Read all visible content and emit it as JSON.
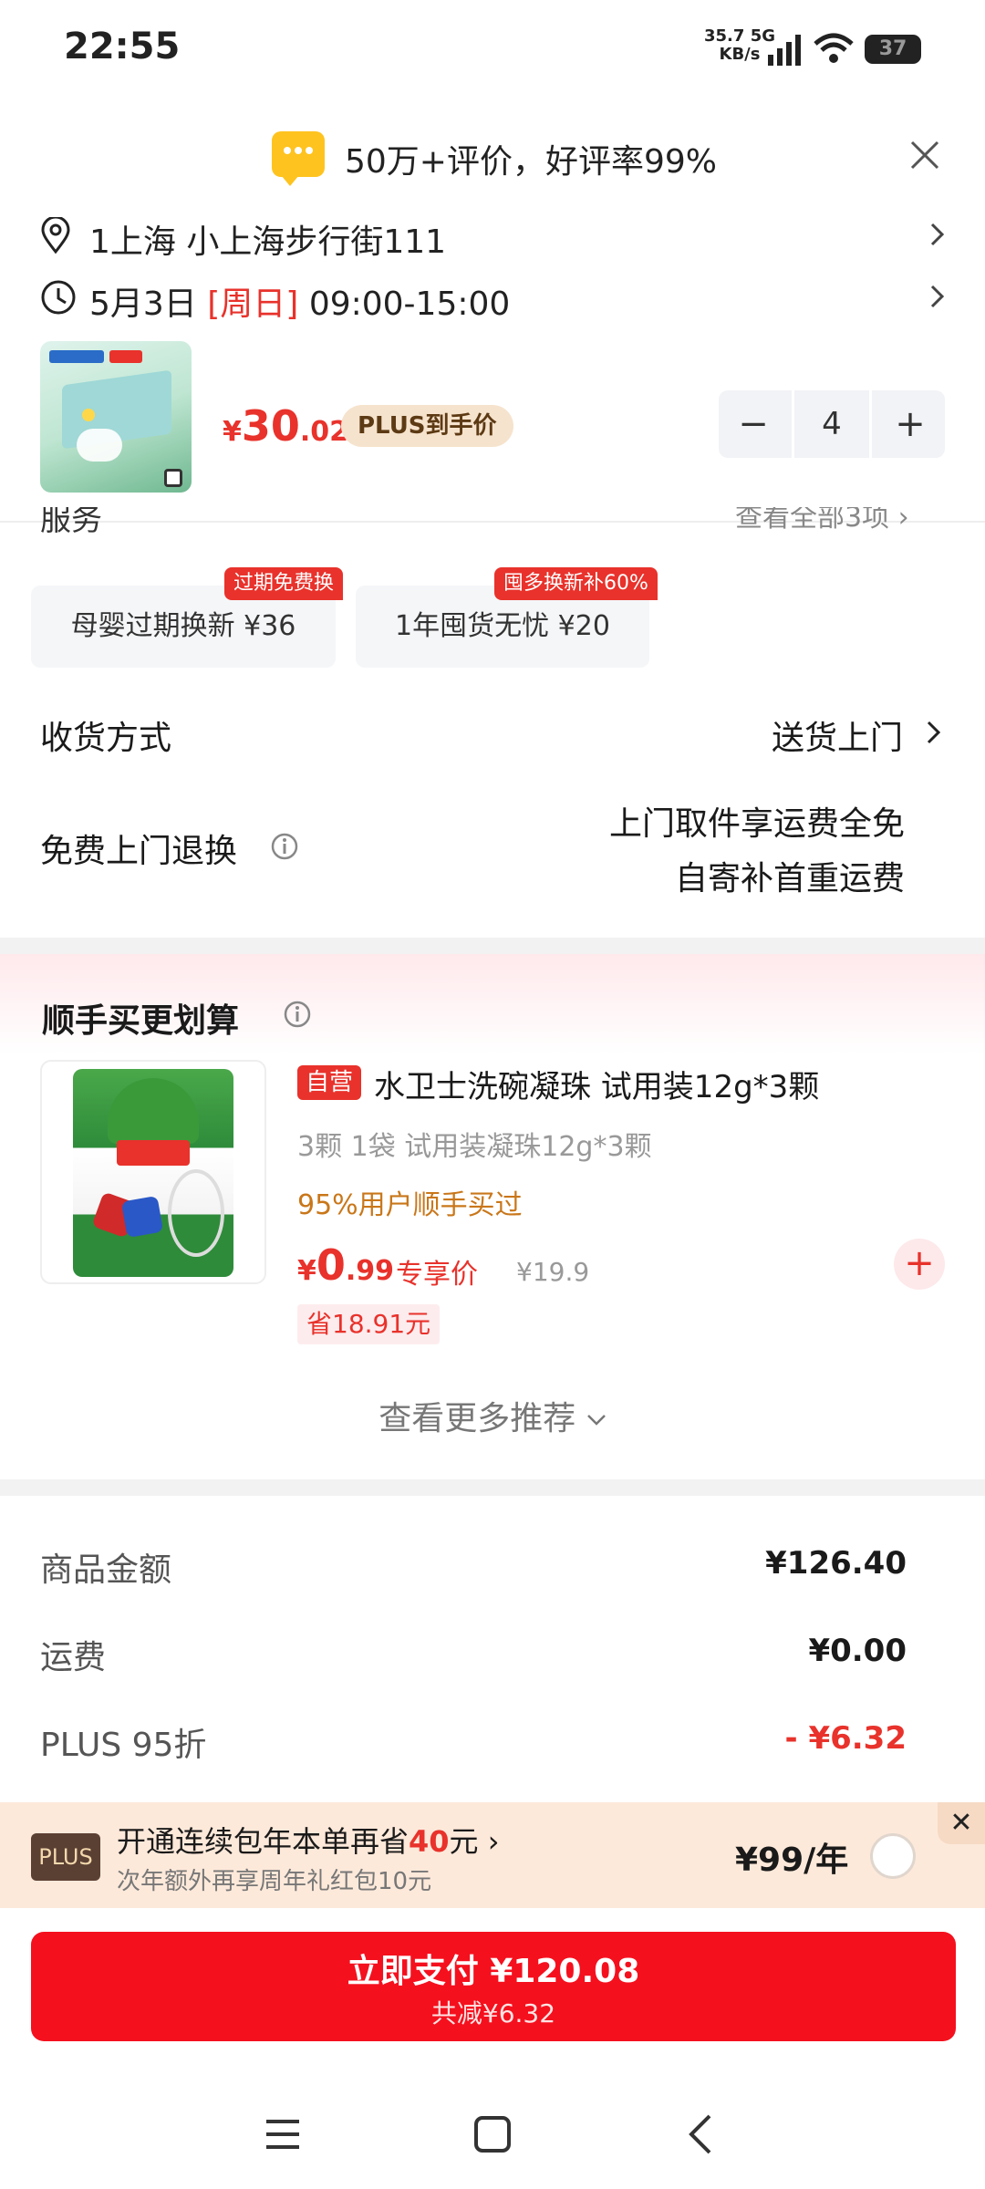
{
  "status_bar": {
    "time": "22:55",
    "net_speed": "35.7",
    "net_unit": "KB/s",
    "network": "5G",
    "battery": "37"
  },
  "review_banner": {
    "text": "50万+评价，好评率99%"
  },
  "address": {
    "text": "1上海  小上海步行街111"
  },
  "delivery": {
    "date": "5月3日",
    "weekday": "[周日]",
    "time": "09:00-15:00"
  },
  "product": {
    "price_symbol": "¥",
    "price_int": "30",
    "price_dec": ".02",
    "plus_tag": "PLUS到手价",
    "quantity": "4"
  },
  "services": {
    "section_cut": "服务",
    "see_all_cut": "查看全部3项",
    "items": [
      {
        "label": "母婴过期换新  ¥36",
        "badge": "过期免费换"
      },
      {
        "label": "1年囤货无忧  ¥20",
        "badge": "囤多换新补60%"
      }
    ]
  },
  "shipping": {
    "label": "收货方式",
    "value": "送货上门"
  },
  "returns": {
    "label": "免费上门退换",
    "line1": "上门取件享运费全免",
    "line2": "自寄补首重运费"
  },
  "recommend": {
    "title": "顺手买更划算",
    "product_name": "水卫士洗碗凝珠 试用装12g*3颗",
    "self_tag": "自营",
    "spec": "3颗 1袋 试用装凝珠12g*3颗",
    "stat": "95%用户顺手买过",
    "price_symbol": "¥",
    "price_int": "0",
    "price_dec": ".99",
    "exclusive": "专享价",
    "original": "¥19.9",
    "save": "省18.91元",
    "more": "查看更多推荐"
  },
  "totals": [
    {
      "label": "商品金额",
      "value": "¥126.40"
    },
    {
      "label": "运费",
      "value": "¥0.00"
    },
    {
      "label": "PLUS 95折",
      "value": "- ¥6.32"
    }
  ],
  "plus_promo": {
    "logo": "PLUS",
    "line1_pre": "开通连续包年本单再省",
    "line1_amount": "40",
    "line1_post": "元",
    "line2": "次年额外再享周年礼红包10元",
    "price": "¥99/年"
  },
  "pay": {
    "label": "立即支付 ¥120.08",
    "sub": "共减¥6.32"
  },
  "colors": {
    "accent": "#e8322b",
    "pay_button": "#f5101e",
    "promo_bg": "#fde9da"
  }
}
